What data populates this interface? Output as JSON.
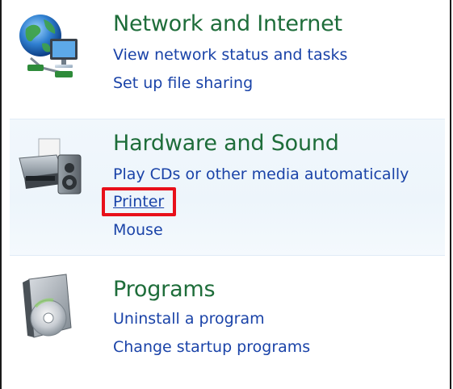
{
  "categories": {
    "network": {
      "title": "Network and Internet",
      "links": [
        "View network status and tasks",
        "Set up file sharing"
      ],
      "icon": "globe-network-icon"
    },
    "hardware": {
      "title": "Hardware and Sound",
      "links": [
        "Play CDs or other media automatically",
        "Printer",
        "Mouse"
      ],
      "icon": "printer-speaker-icon"
    },
    "programs": {
      "title": "Programs",
      "links": [
        "Uninstall a program",
        "Change startup programs"
      ],
      "icon": "software-box-disc-icon"
    }
  },
  "colors": {
    "title": "#1e6d3a",
    "link": "#1a43a8",
    "highlight": "#e8101a",
    "hover_panel": "#edf5fb"
  }
}
